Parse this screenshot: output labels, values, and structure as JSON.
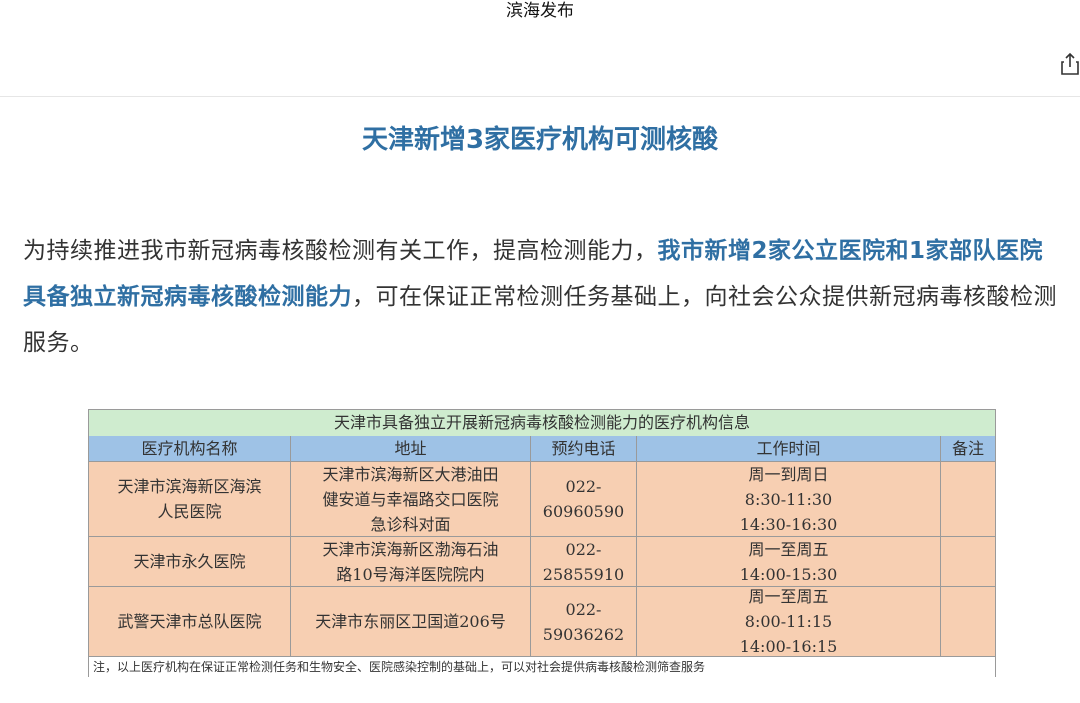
{
  "topbar": {
    "title": "滨海发布"
  },
  "article": {
    "headline": "天津新增3家医疗机构可测核酸",
    "para_part1": "为持续推进我市新冠病毒核酸检测有关工作，提高检测能力，",
    "para_highlight": "我市新增2家公立医院和1家部队医院具备独立新冠病毒核酸检测能力",
    "para_part2": "，可在保证正常检测任务基础上，向社会公众提供新冠病毒核酸检测服务。"
  },
  "table": {
    "caption": "天津市具备独立开展新冠病毒核酸检测能力的医疗机构信息",
    "headers": {
      "name": "医疗机构名称",
      "address": "地址",
      "phone": "预约电话",
      "hours": "工作时间",
      "remark": "备注"
    },
    "rows": [
      {
        "name": "天津市滨海新区海滨\n人民医院",
        "address": "天津市滨海新区大港油田\n健安道与幸福路交口医院\n急诊科对面",
        "phone": "022-\n60960590",
        "hours": "周一到周日\n8:30-11:30\n14:30-16:30",
        "remark": ""
      },
      {
        "name": "天津市永久医院",
        "address": "天津市滨海新区渤海石油\n路10号海洋医院院内",
        "phone": "022-\n25855910",
        "hours": "周一至周五\n14:00-15:30",
        "remark": ""
      },
      {
        "name": "武警天津市总队医院",
        "address": "天津市东丽区卫国道206号",
        "phone": "022-\n59036262",
        "hours": "周一至周五\n8:00-11:15\n14:00-16:15",
        "remark": ""
      }
    ],
    "note": "注，以上医疗机构在保证正常检测任务和生物安全、医院感染控制的基础上，可以对社会提供病毒核酸检测筛查服务"
  },
  "icons": {
    "share": "share-icon"
  },
  "colors": {
    "headline": "#2f6fa3",
    "caption_bg": "#cfeccf",
    "header_bg": "#9ec2e6",
    "body_bg": "#f7cfb2"
  }
}
